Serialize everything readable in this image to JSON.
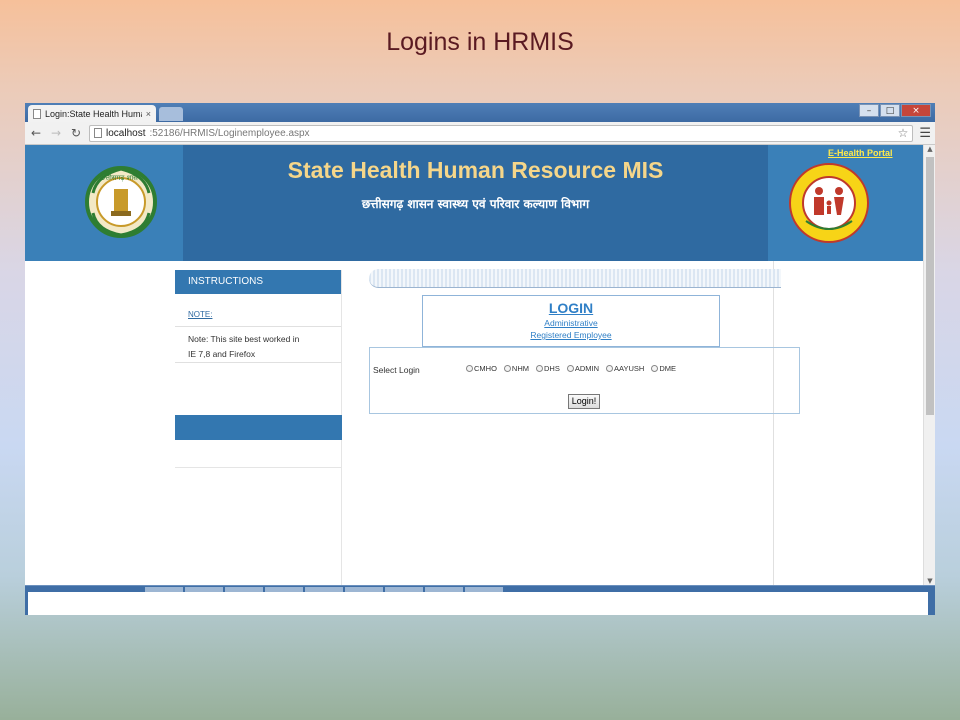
{
  "slide": {
    "title": "Logins in HRMIS"
  },
  "browser": {
    "tab_title": "Login:State Health Human",
    "tab_close": "×",
    "url_host": "localhost",
    "url_path": ":52186/HRMIS/Loginemployee.aspx",
    "window_buttons": {
      "minimize": "–",
      "maximize": "□",
      "close": "×"
    }
  },
  "header": {
    "title": "State Health Human Resource MIS",
    "subtitle": "छत्तीसगढ़ शासन स्वास्थ्य एवं परिवार कल्याण विभाग",
    "ehealth_link": "E-Health Portal",
    "emblem_text": "छत्तीसगढ़ शासन",
    "nrhm_text": "NATIONAL RURAL HEALTH MISSION",
    "colors": {
      "title": "#f5d68a",
      "header_bg": "#2f6aa1",
      "side_bg": "#3a80b8"
    }
  },
  "sidebar": {
    "heading": "INSTRUCTIONS",
    "note_label": "NOTE:",
    "note_line1": "Note: This site best worked in",
    "note_line2": "IE 7,8 and Firefox"
  },
  "login": {
    "title": "LOGIN",
    "link_admin": "Administrative",
    "link_employee": "Registered Employee",
    "select_label": "Select Login",
    "options": [
      "CMHO",
      "NHM",
      "DHS",
      "ADMIN",
      "AAYUSH",
      "DME"
    ],
    "button": "Login!"
  },
  "icons": {
    "back": "arrow-left-icon",
    "forward": "arrow-right-icon",
    "reload": "reload-icon",
    "bookmark": "star-icon",
    "menu": "hamburger-menu-icon"
  }
}
